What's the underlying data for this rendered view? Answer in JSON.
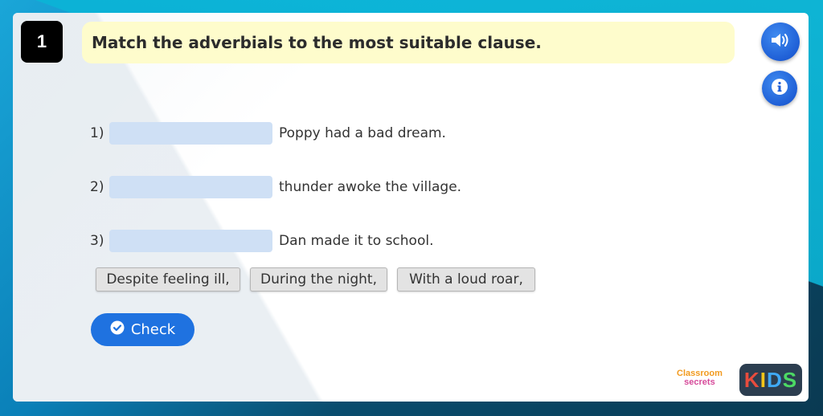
{
  "question": {
    "number": "1",
    "text": "Match the adverbials to the most suitable clause."
  },
  "toolbar": {
    "audio_icon": "speaker-icon",
    "info_icon": "info-icon"
  },
  "rows": [
    {
      "label": "1)",
      "slot_value": "",
      "clause": "Poppy had a bad dream."
    },
    {
      "label": "2)",
      "slot_value": "",
      "clause": "thunder awoke the village."
    },
    {
      "label": "3)",
      "slot_value": "",
      "clause": "Dan made it to school."
    }
  ],
  "options": [
    "Despite feeling ill,",
    "During the night,",
    "With a loud roar,"
  ],
  "check_button": {
    "label": "Check",
    "icon": "check-circle-icon"
  },
  "branding": {
    "classroom": "Classroom",
    "secrets": "secrets",
    "kids": [
      "K",
      "I",
      "D",
      "S"
    ],
    "kids_colors": [
      "#e84c3d",
      "#f5c518",
      "#3fa9f5",
      "#4cd964"
    ]
  },
  "colors": {
    "accent": "#1f72e0",
    "question_bg": "#fefccc",
    "slot_bg": "#cfe0f5"
  }
}
